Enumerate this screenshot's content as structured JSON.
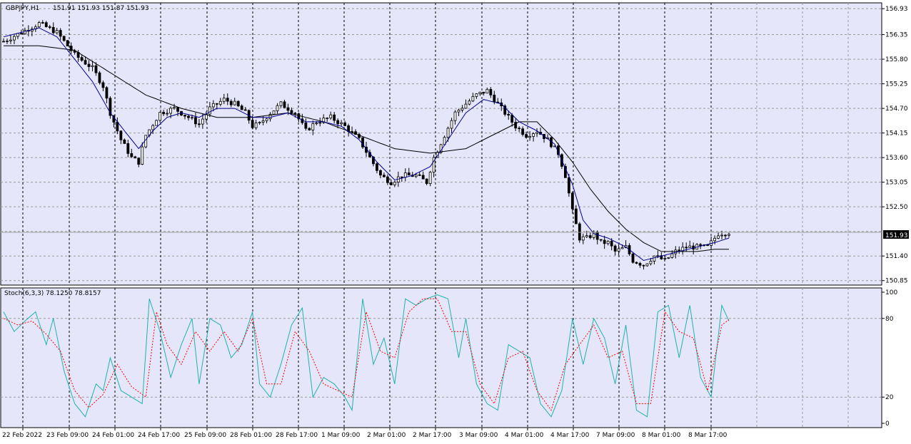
{
  "header": {
    "symbol": "GBPJPY,H1",
    "ohlc": "151.91 151.93 151.87 151.93"
  },
  "current_price_label": "151.93",
  "stoch_header": "Stoch(6,3,3) 78.1250 78.8157",
  "colors": {
    "background": "#e6e6fa",
    "grid": "#999999",
    "candles": "#000000",
    "ma_fast": "#00008b",
    "ma_slow": "#000000",
    "stoch_main": "#20b2aa",
    "stoch_signal": "#ff0000",
    "price_line": "#a0a0a0"
  },
  "chart_data": [
    {
      "type": "candlestick",
      "title": "GBPJPY,H1",
      "x_tick_labels": [
        "22 Feb 2022",
        "23 Feb 09:00",
        "24 Feb 01:00",
        "24 Feb 17:00",
        "25 Feb 09:00",
        "28 Feb 01:00",
        "28 Feb 17:00",
        "1 Mar 09:00",
        "2 Mar 01:00",
        "2 Mar 17:00",
        "3 Mar 09:00",
        "4 Mar 01:00",
        "4 Mar 17:00",
        "7 Mar 09:00",
        "8 Mar 01:00",
        "8 Mar 17:00"
      ],
      "y_tick_labels": [
        "156.93",
        "156.35",
        "155.80",
        "155.25",
        "154.70",
        "154.15",
        "153.60",
        "153.05",
        "152.50",
        "151.40",
        "150.85"
      ],
      "ylim": [
        150.75,
        157.06
      ],
      "current_price": 151.93,
      "grid": true,
      "series": [
        {
          "name": "close",
          "points": [
            [
              0,
              156.2
            ],
            [
              5,
              156.4
            ],
            [
              10,
              156.6
            ],
            [
              15,
              156.4
            ],
            [
              20,
              155.9
            ],
            [
              25,
              155.6
            ],
            [
              28,
              155.2
            ],
            [
              30,
              154.6
            ],
            [
              33,
              154.0
            ],
            [
              36,
              153.6
            ],
            [
              38,
              153.5
            ],
            [
              40,
              154.1
            ],
            [
              44,
              154.6
            ],
            [
              48,
              154.7
            ],
            [
              52,
              154.5
            ],
            [
              55,
              154.35
            ],
            [
              58,
              154.7
            ],
            [
              62,
              154.9
            ],
            [
              65,
              154.8
            ],
            [
              68,
              154.6
            ],
            [
              70,
              154.3
            ],
            [
              72,
              154.35
            ],
            [
              75,
              154.6
            ],
            [
              78,
              154.8
            ],
            [
              82,
              154.6
            ],
            [
              85,
              154.2
            ],
            [
              88,
              154.4
            ],
            [
              92,
              154.5
            ],
            [
              96,
              154.3
            ],
            [
              100,
              154.0
            ],
            [
              103,
              153.6
            ],
            [
              106,
              153.2
            ],
            [
              109,
              153.05
            ],
            [
              112,
              153.2
            ],
            [
              116,
              153.2
            ],
            [
              119,
              153.05
            ],
            [
              121,
              153.6
            ],
            [
              124,
              154.1
            ],
            [
              127,
              154.6
            ],
            [
              130,
              154.8
            ],
            [
              133,
              155.0
            ],
            [
              136,
              155.1
            ],
            [
              138,
              154.9
            ],
            [
              141,
              154.6
            ],
            [
              144,
              154.3
            ],
            [
              147,
              154.1
            ],
            [
              150,
              154.2
            ],
            [
              153,
              154.0
            ],
            [
              156,
              153.7
            ],
            [
              158,
              153.2
            ],
            [
              160,
              152.4
            ],
            [
              162,
              151.8
            ],
            [
              164,
              151.8
            ],
            [
              166,
              151.9
            ],
            [
              168,
              151.7
            ],
            [
              170,
              151.7
            ],
            [
              172,
              151.5
            ],
            [
              175,
              151.6
            ],
            [
              177,
              151.3
            ],
            [
              180,
              151.2
            ],
            [
              183,
              151.4
            ],
            [
              186,
              151.3
            ],
            [
              189,
              151.5
            ],
            [
              192,
              151.6
            ],
            [
              195,
              151.6
            ],
            [
              198,
              151.6
            ],
            [
              201,
              151.9
            ],
            [
              204,
              151.93
            ]
          ]
        },
        {
          "name": "ma_fast",
          "points": [
            [
              0,
              156.3
            ],
            [
              10,
              156.5
            ],
            [
              15,
              156.3
            ],
            [
              20,
              155.8
            ],
            [
              25,
              155.3
            ],
            [
              30,
              154.6
            ],
            [
              35,
              154.1
            ],
            [
              38,
              153.8
            ],
            [
              42,
              154.2
            ],
            [
              46,
              154.5
            ],
            [
              50,
              154.6
            ],
            [
              55,
              154.5
            ],
            [
              60,
              154.7
            ],
            [
              65,
              154.7
            ],
            [
              70,
              154.5
            ],
            [
              75,
              154.5
            ],
            [
              80,
              154.6
            ],
            [
              85,
              154.4
            ],
            [
              90,
              154.4
            ],
            [
              95,
              154.3
            ],
            [
              100,
              154.0
            ],
            [
              105,
              153.5
            ],
            [
              110,
              153.1
            ],
            [
              115,
              153.2
            ],
            [
              120,
              153.4
            ],
            [
              125,
              154.0
            ],
            [
              130,
              154.6
            ],
            [
              135,
              154.9
            ],
            [
              140,
              154.8
            ],
            [
              145,
              154.4
            ],
            [
              150,
              154.2
            ],
            [
              155,
              153.9
            ],
            [
              160,
              153.0
            ],
            [
              163,
              152.2
            ],
            [
              166,
              151.9
            ],
            [
              170,
              151.8
            ],
            [
              175,
              151.6
            ],
            [
              180,
              151.3
            ],
            [
              185,
              151.4
            ],
            [
              190,
              151.5
            ],
            [
              195,
              151.6
            ],
            [
              200,
              151.7
            ],
            [
              204,
              151.8
            ]
          ]
        },
        {
          "name": "ma_slow",
          "points": [
            [
              0,
              156.1
            ],
            [
              10,
              156.1
            ],
            [
              20,
              156.0
            ],
            [
              30,
              155.5
            ],
            [
              40,
              155.0
            ],
            [
              50,
              154.7
            ],
            [
              60,
              154.5
            ],
            [
              70,
              154.5
            ],
            [
              80,
              154.6
            ],
            [
              90,
              154.4
            ],
            [
              100,
              154.1
            ],
            [
              110,
              153.8
            ],
            [
              120,
              153.7
            ],
            [
              130,
              153.8
            ],
            [
              140,
              154.2
            ],
            [
              145,
              154.4
            ],
            [
              150,
              154.4
            ],
            [
              155,
              154.0
            ],
            [
              160,
              153.5
            ],
            [
              165,
              152.9
            ],
            [
              170,
              152.4
            ],
            [
              175,
              152.0
            ],
            [
              180,
              151.7
            ],
            [
              185,
              151.5
            ],
            [
              190,
              151.5
            ],
            [
              195,
              151.5
            ],
            [
              200,
              151.55
            ],
            [
              204,
              151.55
            ]
          ]
        }
      ]
    },
    {
      "type": "line",
      "title": "Stoch(6,3,3)",
      "y_tick_labels": [
        "100",
        "80",
        "20",
        "0"
      ],
      "ylim": [
        0,
        100
      ],
      "grid": true,
      "series": [
        {
          "name": "main",
          "points": [
            [
              0,
              85
            ],
            [
              3,
              70
            ],
            [
              6,
              78
            ],
            [
              9,
              85
            ],
            [
              12,
              60
            ],
            [
              14,
              80
            ],
            [
              17,
              40
            ],
            [
              20,
              15
            ],
            [
              23,
              5
            ],
            [
              26,
              30
            ],
            [
              28,
              25
            ],
            [
              30,
              50
            ],
            [
              33,
              25
            ],
            [
              36,
              20
            ],
            [
              39,
              15
            ],
            [
              41,
              95
            ],
            [
              44,
              70
            ],
            [
              47,
              35
            ],
            [
              50,
              60
            ],
            [
              53,
              80
            ],
            [
              55,
              30
            ],
            [
              58,
              80
            ],
            [
              61,
              75
            ],
            [
              64,
              50
            ],
            [
              67,
              60
            ],
            [
              70,
              85
            ],
            [
              72,
              30
            ],
            [
              75,
              20
            ],
            [
              78,
              45
            ],
            [
              81,
              75
            ],
            [
              84,
              88
            ],
            [
              87,
              20
            ],
            [
              90,
              35
            ],
            [
              93,
              30
            ],
            [
              96,
              20
            ],
            [
              98,
              10
            ],
            [
              101,
              95
            ],
            [
              104,
              45
            ],
            [
              107,
              65
            ],
            [
              110,
              30
            ],
            [
              113,
              95
            ],
            [
              116,
              90
            ],
            [
              119,
              95
            ],
            [
              122,
              98
            ],
            [
              125,
              95
            ],
            [
              128,
              50
            ],
            [
              130,
              80
            ],
            [
              133,
              30
            ],
            [
              136,
              15
            ],
            [
              139,
              10
            ],
            [
              142,
              60
            ],
            [
              145,
              55
            ],
            [
              148,
              50
            ],
            [
              151,
              15
            ],
            [
              154,
              5
            ],
            [
              157,
              25
            ],
            [
              160,
              80
            ],
            [
              163,
              45
            ],
            [
              166,
              80
            ],
            [
              169,
              65
            ],
            [
              172,
              30
            ],
            [
              175,
              75
            ],
            [
              178,
              10
            ],
            [
              181,
              5
            ],
            [
              184,
              85
            ],
            [
              187,
              90
            ],
            [
              190,
              50
            ],
            [
              193,
              90
            ],
            [
              196,
              35
            ],
            [
              199,
              20
            ],
            [
              202,
              90
            ],
            [
              204,
              78
            ]
          ]
        },
        {
          "name": "signal",
          "points": [
            [
              0,
              80
            ],
            [
              4,
              75
            ],
            [
              8,
              78
            ],
            [
              12,
              68
            ],
            [
              16,
              55
            ],
            [
              20,
              25
            ],
            [
              24,
              12
            ],
            [
              28,
              22
            ],
            [
              32,
              45
            ],
            [
              36,
              28
            ],
            [
              40,
              20
            ],
            [
              43,
              85
            ],
            [
              46,
              60
            ],
            [
              50,
              45
            ],
            [
              54,
              70
            ],
            [
              58,
              55
            ],
            [
              62,
              70
            ],
            [
              66,
              55
            ],
            [
              70,
              80
            ],
            [
              74,
              30
            ],
            [
              78,
              30
            ],
            [
              82,
              70
            ],
            [
              86,
              55
            ],
            [
              90,
              30
            ],
            [
              94,
              25
            ],
            [
              98,
              20
            ],
            [
              102,
              85
            ],
            [
              106,
              55
            ],
            [
              110,
              50
            ],
            [
              114,
              85
            ],
            [
              118,
              95
            ],
            [
              122,
              95
            ],
            [
              126,
              70
            ],
            [
              130,
              70
            ],
            [
              134,
              30
            ],
            [
              138,
              15
            ],
            [
              142,
              50
            ],
            [
              146,
              55
            ],
            [
              150,
              25
            ],
            [
              154,
              10
            ],
            [
              158,
              45
            ],
            [
              162,
              60
            ],
            [
              166,
              75
            ],
            [
              170,
              50
            ],
            [
              174,
              55
            ],
            [
              178,
              15
            ],
            [
              182,
              15
            ],
            [
              186,
              85
            ],
            [
              190,
              70
            ],
            [
              194,
              65
            ],
            [
              198,
              25
            ],
            [
              202,
              75
            ],
            [
              204,
              79
            ]
          ]
        }
      ]
    }
  ]
}
